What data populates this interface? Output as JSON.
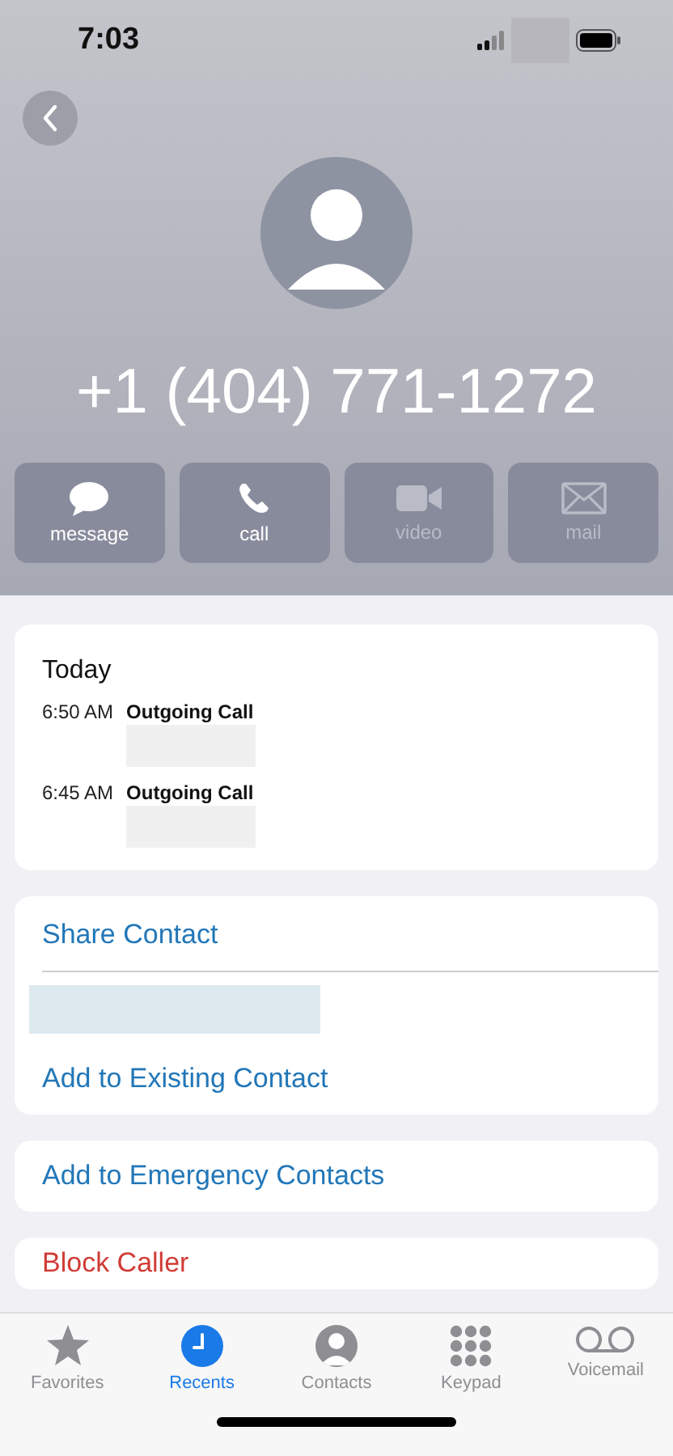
{
  "status_bar": {
    "time": "7:03"
  },
  "contact": {
    "phone": "+1 (404) 771-1272"
  },
  "actions": [
    {
      "kind": "message",
      "label": "message",
      "disabled": false
    },
    {
      "kind": "call",
      "label": "call",
      "disabled": false
    },
    {
      "kind": "video",
      "label": "video",
      "disabled": true
    },
    {
      "kind": "mail",
      "label": "mail",
      "disabled": true
    }
  ],
  "history": {
    "heading": "Today",
    "calls": [
      {
        "time": "6:50 AM",
        "type": "Outgoing Call"
      },
      {
        "time": "6:45 AM",
        "type": "Outgoing Call"
      }
    ]
  },
  "contact_actions": [
    "Share Contact",
    "Add to Existing Contact"
  ],
  "emergency_action": "Add to Emergency Contacts",
  "block_action": "Block Caller",
  "tabs": [
    {
      "kind": "favorites",
      "label": "Favorites",
      "selected": false
    },
    {
      "kind": "recents",
      "label": "Recents",
      "selected": true
    },
    {
      "kind": "contacts",
      "label": "Contacts",
      "selected": false
    },
    {
      "kind": "keypad",
      "label": "Keypad",
      "selected": false
    },
    {
      "kind": "voicemail",
      "label": "Voicemail",
      "selected": false
    }
  ]
}
